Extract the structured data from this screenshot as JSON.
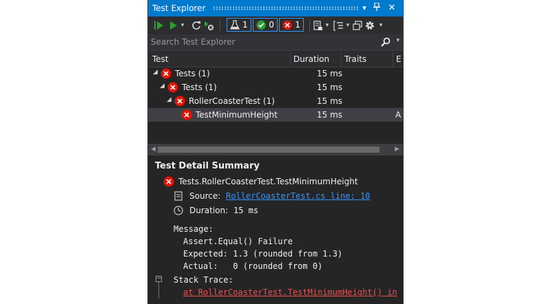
{
  "window": {
    "title": "Test Explorer"
  },
  "search": {
    "placeholder": "Search Test Explorer"
  },
  "toolbar": {
    "filter_total_count": "1",
    "filter_passed_count": "0",
    "filter_failed_count": "1"
  },
  "columns": {
    "test": "Test",
    "duration": "Duration",
    "traits": "Traits",
    "fourth": "E"
  },
  "tree": [
    {
      "label": "Tests (1)",
      "duration": "15 ms"
    },
    {
      "label": "Tests (1)",
      "duration": "15 ms"
    },
    {
      "label": "RollerCoasterTest (1)",
      "duration": "15 ms"
    },
    {
      "label": "TestMinimumHeight",
      "duration": "15 ms",
      "trait_truncated": "A"
    }
  ],
  "detail": {
    "heading": "Test Detail Summary",
    "test_name": "Tests.RollerCoasterTest.TestMinimumHeight",
    "source_label": "Source:",
    "source_link": "RollerCoasterTest.cs line: 10",
    "duration_label": "Duration:",
    "duration_value": "15 ms",
    "message_label": "Message:",
    "message_lines": [
      "Assert.Equal() Failure",
      "Expected: 1.3 (rounded from 1.3)",
      "Actual:   0 (rounded from 0)"
    ],
    "stack_label": "Stack Trace:",
    "stack_line": "at RollerCoasterTest.TestMinimumHeight() in"
  },
  "colors": {
    "accent": "#007acc",
    "failure": "#e51400",
    "success": "#2e9e2e",
    "link": "#3794ff"
  }
}
